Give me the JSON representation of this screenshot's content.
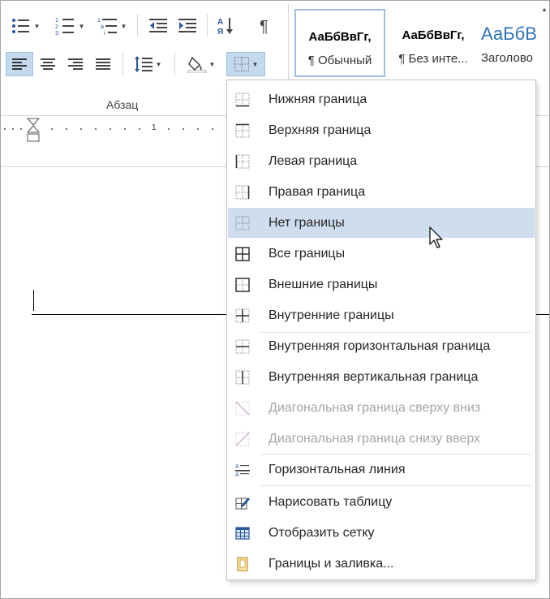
{
  "ribbon": {
    "group_label": "Абзац",
    "styles": [
      {
        "sample": "АаБбВвГг,",
        "name": "¶ Обычный",
        "selected": true
      },
      {
        "sample": "АаБбВвГг,",
        "name": "¶ Без инте...",
        "selected": false
      },
      {
        "sample": "АаБбВ",
        "name": "Заголово",
        "selected": false
      }
    ]
  },
  "ruler": {
    "number": "1"
  },
  "menu": {
    "items": [
      {
        "label": "Нижняя граница",
        "icon": "bottom-border-icon",
        "state": "normal"
      },
      {
        "label": "Верхняя граница",
        "icon": "top-border-icon",
        "state": "normal"
      },
      {
        "label": "Левая граница",
        "icon": "left-border-icon",
        "state": "normal"
      },
      {
        "label": "Правая граница",
        "icon": "right-border-icon",
        "state": "normal"
      },
      {
        "label": "Нет границы",
        "icon": "no-border-icon",
        "state": "hover"
      },
      {
        "label": "Все границы",
        "icon": "all-borders-icon",
        "state": "normal"
      },
      {
        "label": "Внешние границы",
        "icon": "outside-borders-icon",
        "state": "normal"
      },
      {
        "label": "Внутренние границы",
        "icon": "inside-borders-icon",
        "state": "normal"
      },
      {
        "label": "Внутренняя горизонтальная граница",
        "icon": "inside-horizontal-border-icon",
        "state": "normal"
      },
      {
        "label": "Внутренняя вертикальная граница",
        "icon": "inside-vertical-border-icon",
        "state": "normal"
      },
      {
        "label": "Диагональная граница сверху вниз",
        "icon": "diagonal-down-border-icon",
        "state": "disabled"
      },
      {
        "label": "Диагональная граница снизу вверх",
        "icon": "diagonal-up-border-icon",
        "state": "disabled"
      },
      {
        "label": "Горизонтальная линия",
        "icon": "horizontal-line-icon",
        "state": "normal"
      },
      {
        "label": "Нарисовать таблицу",
        "icon": "draw-table-icon",
        "state": "normal"
      },
      {
        "label": "Отобразить сетку",
        "icon": "view-gridlines-icon",
        "state": "normal"
      },
      {
        "label": "Границы и заливка...",
        "icon": "borders-and-shading-icon",
        "state": "normal"
      }
    ]
  },
  "colors": {
    "hover_bg": "#cfddee",
    "active_button_bg": "#c5d9ee",
    "disabled_text": "#a6a6a6",
    "heading_style": "#2e74b5"
  }
}
